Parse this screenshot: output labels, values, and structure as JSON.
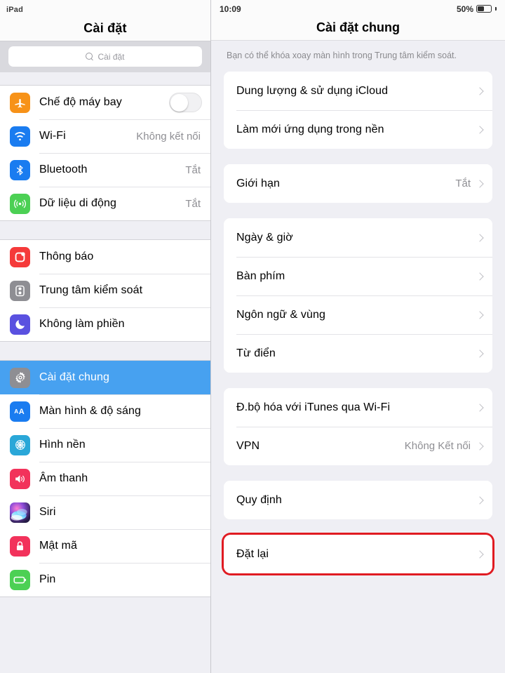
{
  "sidebar": {
    "device_label": "iPad",
    "title": "Cài đặt",
    "search_placeholder": "Cài đặt",
    "groups": [
      {
        "items": [
          {
            "label": "Chế độ máy bay",
            "icon": "airplane-icon",
            "color": "#f79218",
            "control": "toggle",
            "toggle_on": false
          },
          {
            "label": "Wi-Fi",
            "icon": "wifi-icon",
            "color": "#1a7cf0",
            "value": "Không kết nối"
          },
          {
            "label": "Bluetooth",
            "icon": "bluetooth-icon",
            "color": "#1a7cf0",
            "value": "Tắt"
          },
          {
            "label": "Dữ liệu di động",
            "icon": "cellular-icon",
            "color": "#4cd054",
            "value": "Tắt"
          }
        ]
      },
      {
        "items": [
          {
            "label": "Thông báo",
            "icon": "notifications-icon",
            "color": "#f53a3a"
          },
          {
            "label": "Trung tâm kiểm soát",
            "icon": "control-center-icon",
            "color": "#8e8e93"
          },
          {
            "label": "Không làm phiền",
            "icon": "moon-icon",
            "color": "#5a51e0"
          }
        ]
      },
      {
        "items": [
          {
            "label": "Cài đặt chung",
            "icon": "gear-icon",
            "color": "#8e8e93",
            "selected": true
          },
          {
            "label": "Màn hình & độ sáng",
            "icon": "display-aa-icon",
            "color": "#1a7cf0"
          },
          {
            "label": "Hình nền",
            "icon": "wallpaper-flower-icon",
            "color": "#2aa7d8"
          },
          {
            "label": "Âm thanh",
            "icon": "speaker-icon",
            "color": "#f2325b"
          },
          {
            "label": "Siri",
            "icon": "siri-icon",
            "color": "#2b1e4a"
          },
          {
            "label": "Mật mã",
            "icon": "lock-icon",
            "color": "#f2325b"
          },
          {
            "label": "Pin",
            "icon": "battery-icon",
            "color": "#4cd054"
          }
        ]
      }
    ]
  },
  "detail": {
    "status_bar": {
      "time": "10:09",
      "battery_percent": "50%"
    },
    "title": "Cài đặt chung",
    "footer_note": "Bạn có thể khóa xoay màn hình trong Trung tâm kiểm soát.",
    "groups": [
      {
        "highlighted": false,
        "rows": [
          {
            "label": "Dung lượng & sử dụng iCloud",
            "value": "",
            "chevron": true
          },
          {
            "label": "Làm mới ứng dụng trong nền",
            "value": "",
            "chevron": true
          }
        ]
      },
      {
        "highlighted": false,
        "rows": [
          {
            "label": "Giới hạn",
            "value": "Tắt",
            "chevron": true
          }
        ]
      },
      {
        "highlighted": false,
        "rows": [
          {
            "label": "Ngày & giờ",
            "value": "",
            "chevron": true
          },
          {
            "label": "Bàn phím",
            "value": "",
            "chevron": true
          },
          {
            "label": "Ngôn ngữ & vùng",
            "value": "",
            "chevron": true
          },
          {
            "label": "Từ điển",
            "value": "",
            "chevron": true
          }
        ]
      },
      {
        "highlighted": false,
        "rows": [
          {
            "label": "Đ.bộ hóa với iTunes qua Wi-Fi",
            "value": "",
            "chevron": true
          },
          {
            "label": "VPN",
            "value": "Không Kết nối",
            "chevron": true
          }
        ]
      },
      {
        "highlighted": false,
        "rows": [
          {
            "label": "Quy định",
            "value": "",
            "chevron": true
          }
        ]
      },
      {
        "highlighted": true,
        "rows": [
          {
            "label": "Đặt lại",
            "value": "",
            "chevron": true
          }
        ]
      }
    ]
  },
  "colors": {
    "selection_blue": "#47a1f0",
    "highlight_red": "#e01b22",
    "background_gray": "#efeff4",
    "value_gray": "#8e8e93"
  }
}
